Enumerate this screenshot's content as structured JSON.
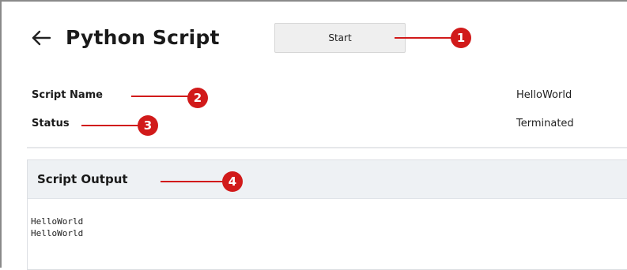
{
  "header": {
    "back_icon": "arrow-left-icon",
    "title": "Python Script",
    "start_label": "Start"
  },
  "fields": {
    "script_name_label": "Script Name",
    "script_name_value": "HelloWorld",
    "status_label": "Status",
    "status_value": "Terminated"
  },
  "output": {
    "title": "Script Output",
    "lines": [
      "HelloWorld",
      "HelloWorld"
    ]
  },
  "callouts": [
    "1",
    "2",
    "3",
    "4"
  ],
  "colors": {
    "callout_red": "#d11a1a",
    "panel_header_bg": "#eef1f4",
    "button_bg": "#efefef"
  }
}
